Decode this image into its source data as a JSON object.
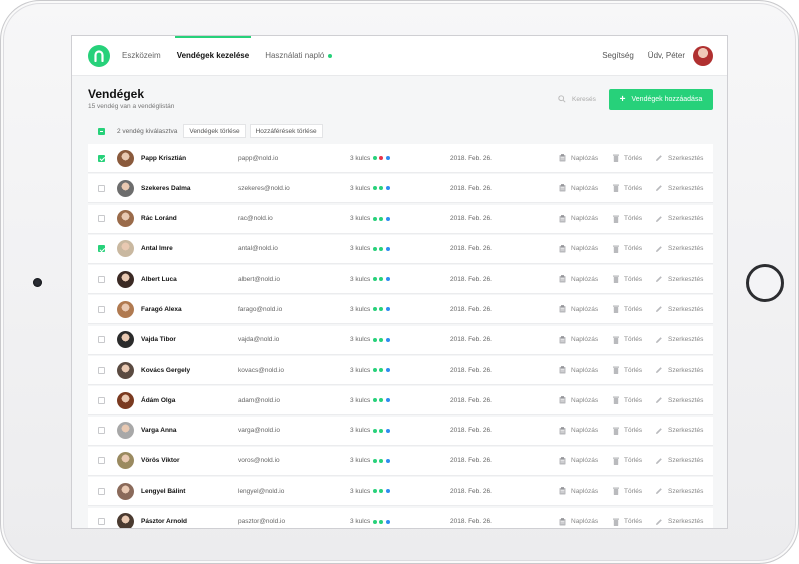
{
  "app": {
    "nav": [
      {
        "label": "Eszközeim"
      },
      {
        "label": "Vendégek kezelése"
      },
      {
        "label": "Használati napló"
      }
    ],
    "help_label": "Segítség",
    "greeting": "Üdv, Péter"
  },
  "page": {
    "title": "Vendégek",
    "subtitle": "15 vendég van a vendéglistán",
    "search_placeholder": "Keresés",
    "add_button": "Vendégek hozzáadása"
  },
  "selection": {
    "count_text": "2 vendég kiválasztva",
    "delete_guests": "Vendégek törlése",
    "delete_access": "Hozzáférések törlése"
  },
  "actions": {
    "log": "Naplózás",
    "delete": "Törlés",
    "edit": "Szerkesztés"
  },
  "colors": {
    "accent": "#27d17a",
    "key_green": "#27d17a",
    "key_red": "#e8334a",
    "key_blue": "#2f8cf0"
  },
  "guests": [
    {
      "name": "Papp Krisztián",
      "email": "papp@nold.io",
      "keys": "3 kulcs",
      "key_colors": [
        "#27d17a",
        "#e8334a",
        "#2f8cf0"
      ],
      "date": "2018. Feb. 26.",
      "checked": true,
      "avatar": "#8a5a3c"
    },
    {
      "name": "Szekeres Dalma",
      "email": "szekeres@nold.io",
      "keys": "3 kulcs",
      "key_colors": [
        "#27d17a",
        "#27d17a",
        "#2f8cf0"
      ],
      "date": "2018. Feb. 26.",
      "checked": false,
      "avatar": "#6d6d6d"
    },
    {
      "name": "Rác Loránd",
      "email": "rac@nold.io",
      "keys": "3 kulcs",
      "key_colors": [
        "#27d17a",
        "#27d17a",
        "#2f8cf0"
      ],
      "date": "2018. Feb. 26.",
      "checked": false,
      "avatar": "#9a6b4a"
    },
    {
      "name": "Antal Imre",
      "email": "antal@nold.io",
      "keys": "3 kulcs",
      "key_colors": [
        "#27d17a",
        "#27d17a",
        "#2f8cf0"
      ],
      "date": "2018. Feb. 26.",
      "checked": true,
      "avatar": "#c9b8a0"
    },
    {
      "name": "Albert Luca",
      "email": "albert@nold.io",
      "keys": "3 kulcs",
      "key_colors": [
        "#27d17a",
        "#27d17a",
        "#2f8cf0"
      ],
      "date": "2018. Feb. 26.",
      "checked": false,
      "avatar": "#3b2a24"
    },
    {
      "name": "Faragó Alexa",
      "email": "farago@nold.io",
      "keys": "3 kulcs",
      "key_colors": [
        "#27d17a",
        "#27d17a",
        "#2f8cf0"
      ],
      "date": "2018. Feb. 26.",
      "checked": false,
      "avatar": "#b07a50"
    },
    {
      "name": "Vajda Tibor",
      "email": "vajda@nold.io",
      "keys": "3 kulcs",
      "key_colors": [
        "#27d17a",
        "#27d17a",
        "#2f8cf0"
      ],
      "date": "2018. Feb. 26.",
      "checked": false,
      "avatar": "#2b2b2b"
    },
    {
      "name": "Kovács Gergely",
      "email": "kovacs@nold.io",
      "keys": "3 kulcs",
      "key_colors": [
        "#27d17a",
        "#27d17a",
        "#2f8cf0"
      ],
      "date": "2018. Feb. 26.",
      "checked": false,
      "avatar": "#5a4a40"
    },
    {
      "name": "Ádám Olga",
      "email": "adam@nold.io",
      "keys": "3 kulcs",
      "key_colors": [
        "#27d17a",
        "#27d17a",
        "#2f8cf0"
      ],
      "date": "2018. Feb. 26.",
      "checked": false,
      "avatar": "#7a3a20"
    },
    {
      "name": "Varga Anna",
      "email": "varga@nold.io",
      "keys": "3 kulcs",
      "key_colors": [
        "#27d17a",
        "#27d17a",
        "#2f8cf0"
      ],
      "date": "2018. Feb. 26.",
      "checked": false,
      "avatar": "#a8a8a8"
    },
    {
      "name": "Vörös Viktor",
      "email": "voros@nold.io",
      "keys": "3 kulcs",
      "key_colors": [
        "#27d17a",
        "#27d17a",
        "#2f8cf0"
      ],
      "date": "2018. Feb. 26.",
      "checked": false,
      "avatar": "#9a8a60"
    },
    {
      "name": "Lengyel Bálint",
      "email": "lengyel@nold.io",
      "keys": "3 kulcs",
      "key_colors": [
        "#27d17a",
        "#27d17a",
        "#2f8cf0"
      ],
      "date": "2018. Feb. 26.",
      "checked": false,
      "avatar": "#8a6a5a"
    },
    {
      "name": "Pásztor Arnold",
      "email": "pasztor@nold.io",
      "keys": "3 kulcs",
      "key_colors": [
        "#27d17a",
        "#27d17a",
        "#2f8cf0"
      ],
      "date": "2018. Feb. 26.",
      "checked": false,
      "avatar": "#4a3a30"
    }
  ]
}
